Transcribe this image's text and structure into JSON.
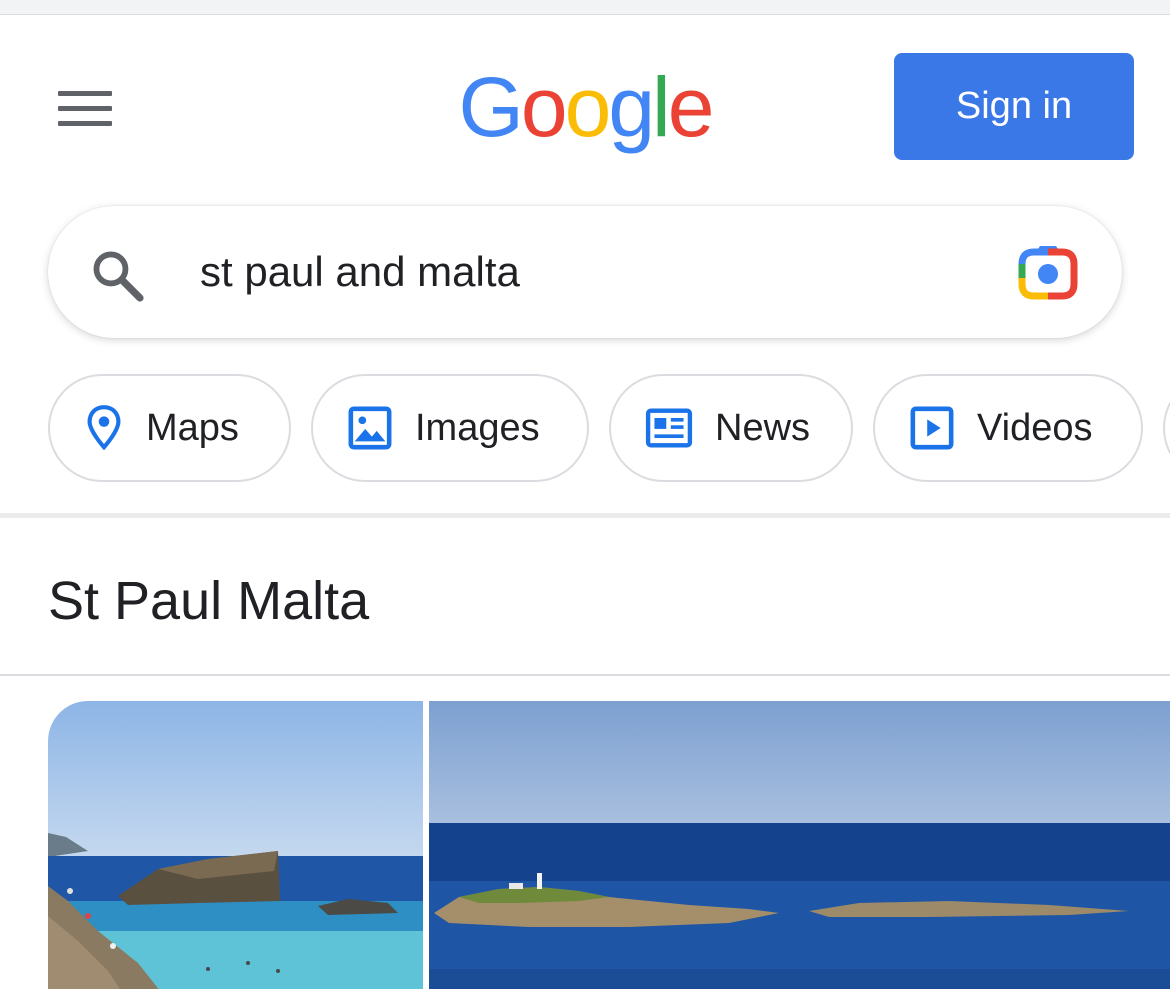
{
  "header": {
    "logo_letters": [
      {
        "char": "G",
        "color": "#4285f4"
      },
      {
        "char": "o",
        "color": "#ea4335"
      },
      {
        "char": "o",
        "color": "#fbbc05"
      },
      {
        "char": "g",
        "color": "#4285f4"
      },
      {
        "char": "l",
        "color": "#34a853"
      },
      {
        "char": "e",
        "color": "#ea4335"
      }
    ],
    "sign_in_label": "Sign in",
    "menu_icon": "hamburger-menu-icon"
  },
  "search": {
    "query": "st paul and malta",
    "search_icon": "magnifier-icon",
    "lens_icon": "google-lens-camera-icon"
  },
  "chips": [
    {
      "label": "Maps",
      "icon": "map-pin-icon"
    },
    {
      "label": "Images",
      "icon": "image-icon"
    },
    {
      "label": "News",
      "icon": "newspaper-icon"
    },
    {
      "label": "Videos",
      "icon": "video-play-icon"
    }
  ],
  "results": {
    "heading": "St Paul Malta"
  },
  "colors": {
    "accent": "#3b78e7",
    "icon_blue": "#1a73e8",
    "text": "#202124",
    "icon_gray": "#5f6368"
  }
}
